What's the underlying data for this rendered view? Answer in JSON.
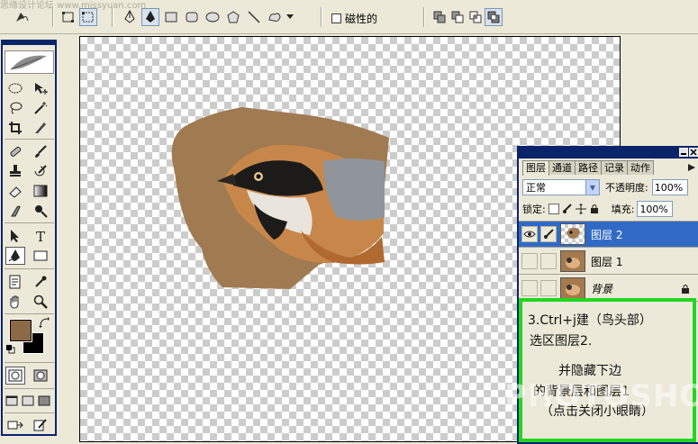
{
  "watermark": "思缘设计论坛  www.missyuan.com",
  "options_bar": {
    "magnetic_label": "磁性的",
    "tools": [
      "shape-layers",
      "paths",
      "pen",
      "freeform-pen",
      "rectangle",
      "rounded-rectangle",
      "ellipse",
      "polygon",
      "line",
      "custom-shape"
    ],
    "selected_tool": "freeform-pen",
    "path_ops": [
      "add",
      "subtract",
      "intersect",
      "exclude"
    ]
  },
  "toolbox": {
    "selected_tool": "freeform-pen",
    "foreground_color": "#8b6a45",
    "background_color": "#000000"
  },
  "layers_panel": {
    "tabs": [
      "图层",
      "通道",
      "路径",
      "记录",
      "动作"
    ],
    "active_tab": "图层",
    "blend_mode": "正常",
    "opacity_label": "不透明度:",
    "opacity_value": "100%",
    "lock_label": "锁定:",
    "fill_label": "填充:",
    "fill_value": "100%",
    "layers": [
      {
        "name": "图层 2",
        "visible": true,
        "active": true,
        "italic": false,
        "locked": false
      },
      {
        "name": "图层 1",
        "visible": false,
        "active": false,
        "italic": false,
        "locked": false
      },
      {
        "name": "背景",
        "visible": false,
        "active": false,
        "italic": true,
        "locked": true
      }
    ]
  },
  "note": {
    "line1": "3.Ctrl+j建（鸟头部）",
    "line2": "选区图层2.",
    "line3": "并隐藏下边",
    "line4": "的背景层和图层1",
    "line5": "（点击关闭小眼睛）",
    "border_color": "#22d622"
  },
  "watermark2": "PHOTOSHOP"
}
